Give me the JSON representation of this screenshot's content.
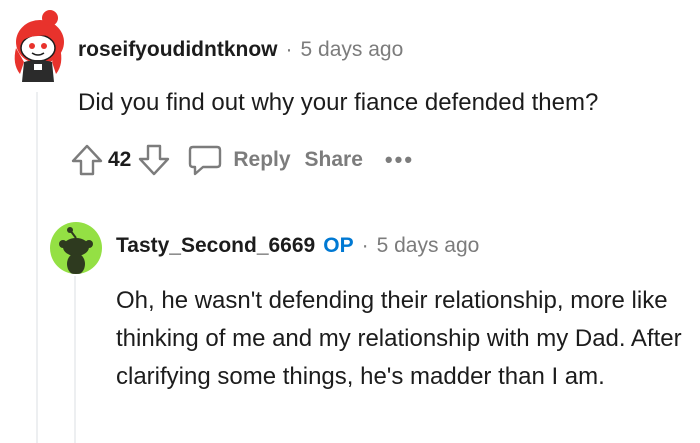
{
  "comment1": {
    "username": "roseifyoudidntknow",
    "separator": "·",
    "time": "5 days ago",
    "body": "Did you find out why your fiance defended them?",
    "score": "42",
    "reply_label": "Reply",
    "share_label": "Share",
    "more_label": "•••"
  },
  "comment2": {
    "username": "Tasty_Second_6669",
    "op_badge": "OP",
    "separator": "·",
    "time": "5 days ago",
    "body": "Oh, he wasn't defending their relationship, more like thinking of me and my relationship with my Dad. After clarifying some things, he's madder than I am."
  },
  "colors": {
    "op_blue": "#0079d3",
    "avatar2_bg": "#94e044",
    "meta_gray": "#7c7c7c",
    "avatar1_hair": "#e8322c"
  },
  "icons": [
    "upvote-icon",
    "downvote-icon",
    "reply-bubble-icon",
    "more-icon",
    "snoo-avatar-icon"
  ]
}
